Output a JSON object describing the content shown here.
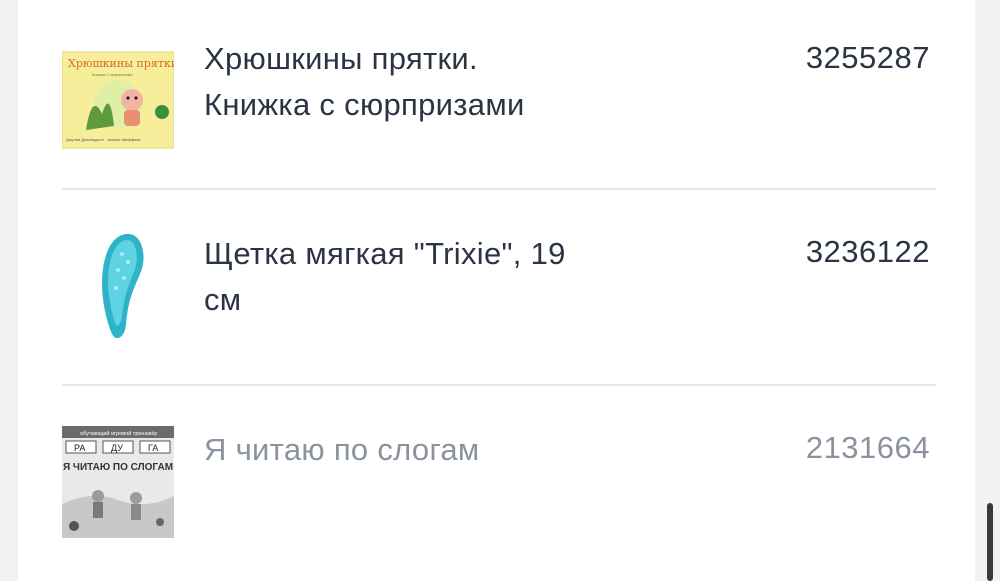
{
  "items": [
    {
      "title_line1": "Хрюшкины прятки.",
      "title_line2": "Книжка с сюрпризами",
      "code": "3255287",
      "thumb_title": "Хрюшкины прятки",
      "thumb_subtitle": "Книжка с сюрпризами",
      "thumb_authors": "Джулия Дональдсон · Аксель Шеффлер",
      "disabled": false
    },
    {
      "title_line1": "Щетка мягкая \"Trixie\", 19",
      "title_line2": "см",
      "code": "3236122",
      "disabled": false
    },
    {
      "title_line1": "Я читаю по слогам",
      "title_line2": "",
      "code": "2131664",
      "thumb_header": "обучающий игровой тренажёр",
      "thumb_syllables": [
        "РА",
        "ДУ",
        "ГА"
      ],
      "thumb_title": "Я ЧИТАЮ ПО СЛОГАМ",
      "disabled": true
    }
  ],
  "colors": {
    "text": "#2b3443",
    "text_disabled": "#8a929e",
    "divider": "#e6e7ea",
    "background": "#ffffff"
  }
}
